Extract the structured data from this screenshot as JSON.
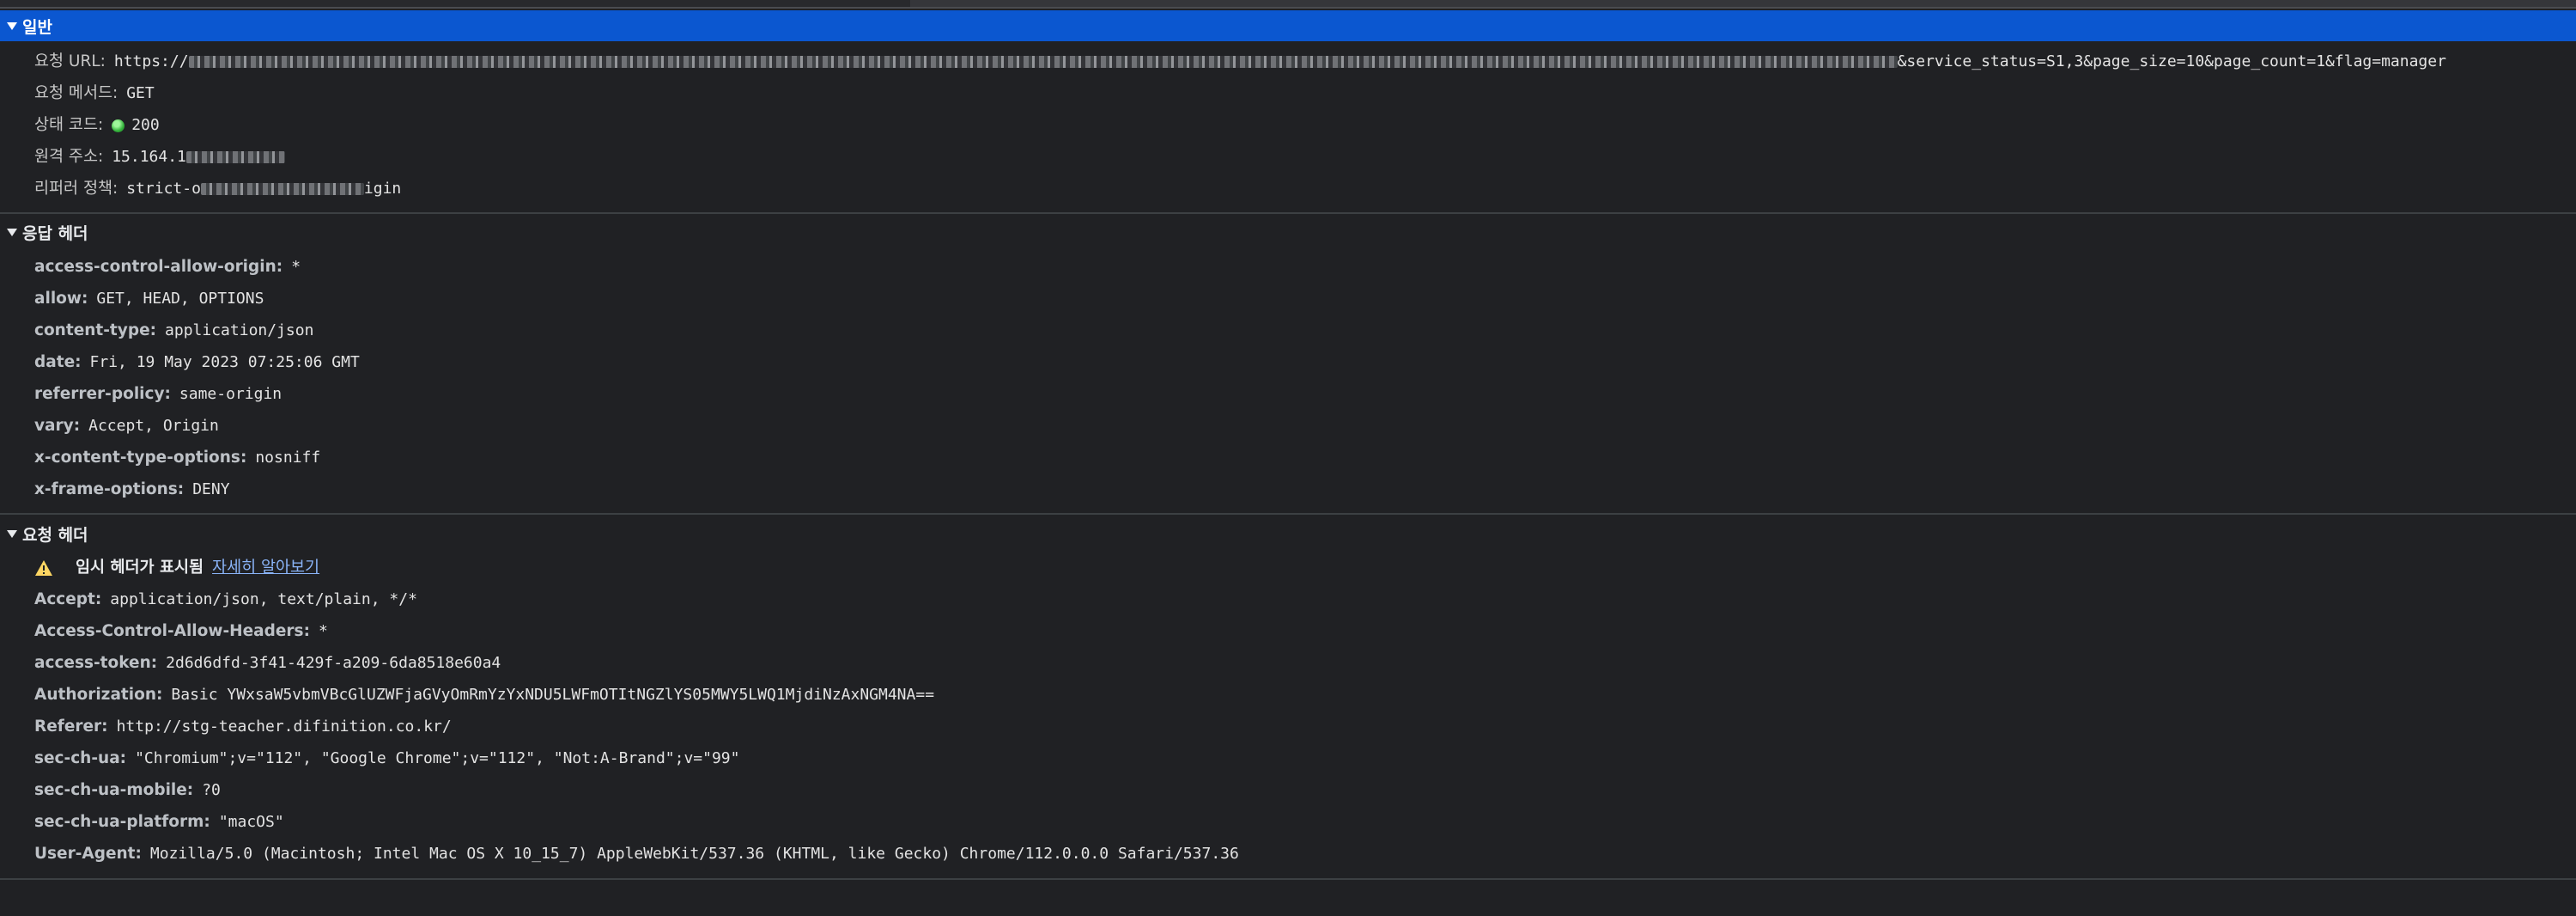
{
  "general": {
    "title": "일반",
    "request_url": {
      "label": "요청 URL:",
      "prefix": "https://",
      "suffix": "&service_status=S1,3&page_size=10&page_count=1&flag=manager"
    },
    "method": {
      "label": "요청 메서드:",
      "value": "GET"
    },
    "status": {
      "label": "상태 코드:",
      "value": "200"
    },
    "remote": {
      "label": "원격 주소:",
      "value": "15.164.1"
    },
    "referrer": {
      "label": "리퍼러 정책:",
      "prefix": "strict-o",
      "suffix": "igin"
    }
  },
  "response_headers": {
    "title": "응답 헤더",
    "items": [
      {
        "key": "access-control-allow-origin:",
        "value": "*"
      },
      {
        "key": "allow:",
        "value": "GET, HEAD, OPTIONS"
      },
      {
        "key": "content-type:",
        "value": "application/json"
      },
      {
        "key": "date:",
        "value": "Fri, 19 May 2023 07:25:06 GMT"
      },
      {
        "key": "referrer-policy:",
        "value": "same-origin"
      },
      {
        "key": "vary:",
        "value": "Accept, Origin"
      },
      {
        "key": "x-content-type-options:",
        "value": "nosniff"
      },
      {
        "key": "x-frame-options:",
        "value": "DENY"
      }
    ]
  },
  "request_headers": {
    "title": "요청 헤더",
    "warning_text": "임시 헤더가 표시됨",
    "warning_link": "자세히 알아보기",
    "items": [
      {
        "key": "Accept:",
        "value": "application/json, text/plain, */*"
      },
      {
        "key": "Access-Control-Allow-Headers:",
        "value": "*"
      },
      {
        "key": "access-token:",
        "value": "2d6d6dfd-3f41-429f-a209-6da8518e60a4"
      },
      {
        "key": "Authorization:",
        "value": "Basic YWxsaW5vbmVBcGlUZWFjaGVyOmRmYzYxNDU5LWFmOTItNGZlYS05MWY5LWQ1MjdiNzAxNGM4NA=="
      },
      {
        "key": "Referer:",
        "value": "http://stg-teacher.difinition.co.kr/"
      },
      {
        "key": "sec-ch-ua:",
        "value": "\"Chromium\";v=\"112\", \"Google Chrome\";v=\"112\", \"Not:A-Brand\";v=\"99\""
      },
      {
        "key": "sec-ch-ua-mobile:",
        "value": "?0"
      },
      {
        "key": "sec-ch-ua-platform:",
        "value": "\"macOS\""
      },
      {
        "key": "User-Agent:",
        "value": "Mozilla/5.0 (Macintosh; Intel Mac OS X 10_15_7) AppleWebKit/537.36 (KHTML, like Gecko) Chrome/112.0.0.0 Safari/537.36"
      }
    ]
  }
}
